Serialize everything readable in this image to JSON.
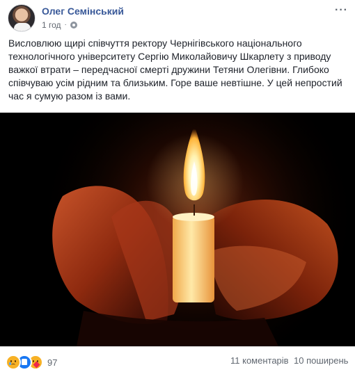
{
  "post": {
    "author": "Олег Семінський",
    "time": "1 год",
    "separator": "·",
    "more_label": "···",
    "text": "Висловлюю щирі співчуття ректору Чернігівського національного технологічного університету Сергію Миколайовичу Шкарлету з приводу важкої втрати – передчасної смерті дружини Тетяни Олегівни. Глибоко співчуваю усім рідним та близьким. Горе ваше невтішне. У цей непростий час я сумую разом із вами.",
    "image_icon": "candle-in-hands-photo"
  },
  "footer": {
    "reactions": [
      "sad-reaction-icon",
      "like-reaction-icon",
      "care-reaction-icon"
    ],
    "reaction_count": "97",
    "comments": "11 коментарів",
    "shares": "10 поширень"
  },
  "colors": {
    "author_link": "#385898",
    "meta_text": "#616770",
    "like_blue": "#1877f2",
    "reaction_yellow": "#f7b125"
  }
}
